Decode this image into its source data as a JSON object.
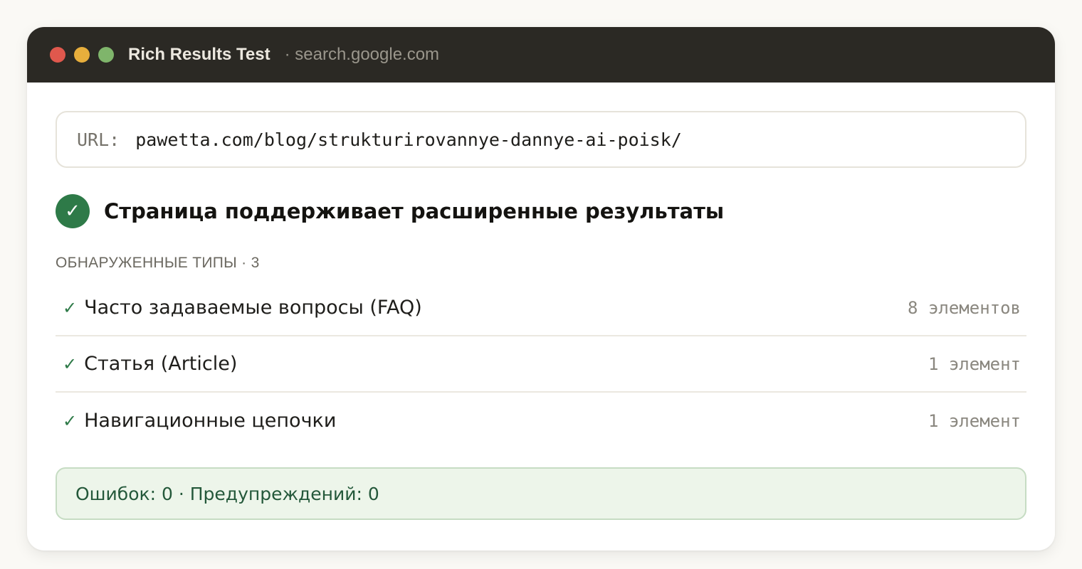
{
  "window": {
    "title": "Rich Results Test",
    "domain": "· search.google.com",
    "traffic_lights": {
      "close": "#e0584d",
      "minimize": "#e7ae3c",
      "maximize": "#7fb56b"
    }
  },
  "url_bar": {
    "label": "URL:",
    "value": "pawetta.com/blog/strukturirovannye-dannye-ai-poisk/"
  },
  "status": {
    "icon": "check-icon",
    "icon_glyph": "✓",
    "text": "Страница поддерживает расширенные результаты",
    "color": "#2e7a48"
  },
  "detected": {
    "label": "ОБНАРУЖЕННЫЕ ТИПЫ · 3",
    "tick": "✓",
    "items": [
      {
        "name": "Часто задаваемые вопросы (FAQ)",
        "count": "8 элементов"
      },
      {
        "name": "Статья (Article)",
        "count": "1 элемент"
      },
      {
        "name": "Навигационные цепочки",
        "count": "1 элемент"
      }
    ]
  },
  "summary": {
    "text": "Ошибок: 0 · Предупреждений: 0"
  }
}
